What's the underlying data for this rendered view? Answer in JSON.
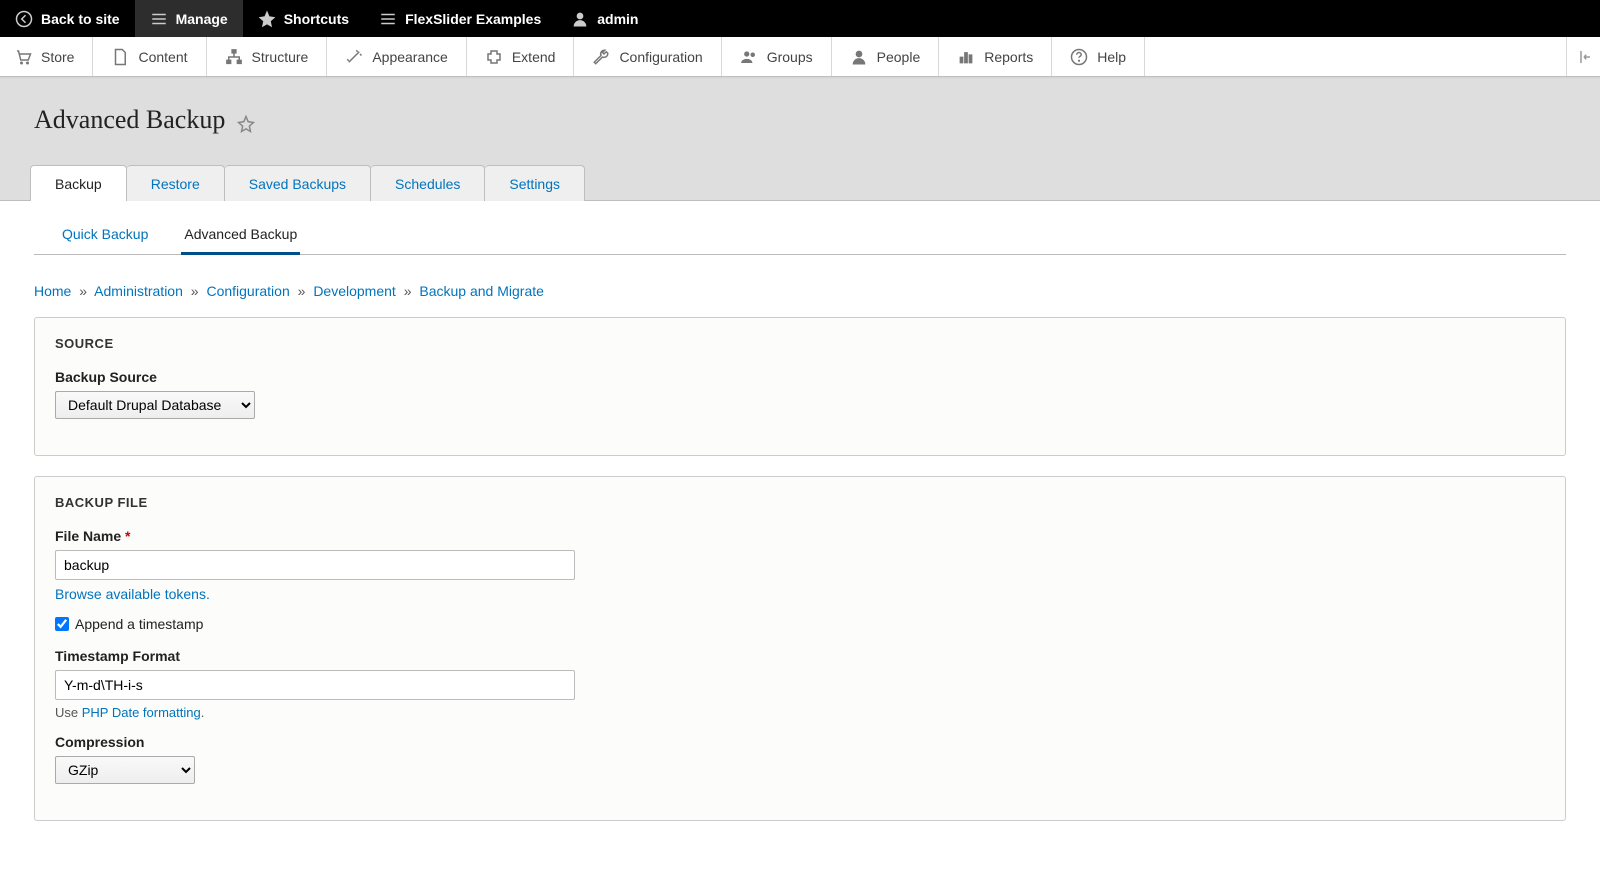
{
  "toolbar": {
    "back": "Back to site",
    "manage": "Manage",
    "shortcuts": "Shortcuts",
    "flex": "FlexSlider Examples",
    "user": "admin"
  },
  "admin_menu": {
    "store": "Store",
    "content": "Content",
    "structure": "Structure",
    "appearance": "Appearance",
    "extend": "Extend",
    "configuration": "Configuration",
    "groups": "Groups",
    "people": "People",
    "reports": "Reports",
    "help": "Help"
  },
  "page_title": "Advanced Backup",
  "primary_tabs": {
    "backup": "Backup",
    "restore": "Restore",
    "saved": "Saved Backups",
    "schedules": "Schedules",
    "settings": "Settings"
  },
  "secondary_tabs": {
    "quick": "Quick Backup",
    "advanced": "Advanced Backup"
  },
  "breadcrumb": {
    "home": "Home",
    "admin": "Administration",
    "config": "Configuration",
    "dev": "Development",
    "bam": "Backup and Migrate",
    "sep": "»"
  },
  "source": {
    "legend": "SOURCE",
    "label": "Backup Source",
    "value": "Default Drupal Database"
  },
  "backup_file": {
    "legend": "BACKUP FILE",
    "file_name_label": "File Name",
    "file_name_value": "backup",
    "tokens_link": "Browse available tokens.",
    "append_label": "Append a timestamp",
    "append_checked": true,
    "ts_label": "Timestamp Format",
    "ts_value": "Y-m-d\\TH-i-s",
    "use_text": "Use ",
    "php_link": "PHP Date formatting",
    "period": ".",
    "compression_label": "Compression",
    "compression_value": "GZip"
  }
}
